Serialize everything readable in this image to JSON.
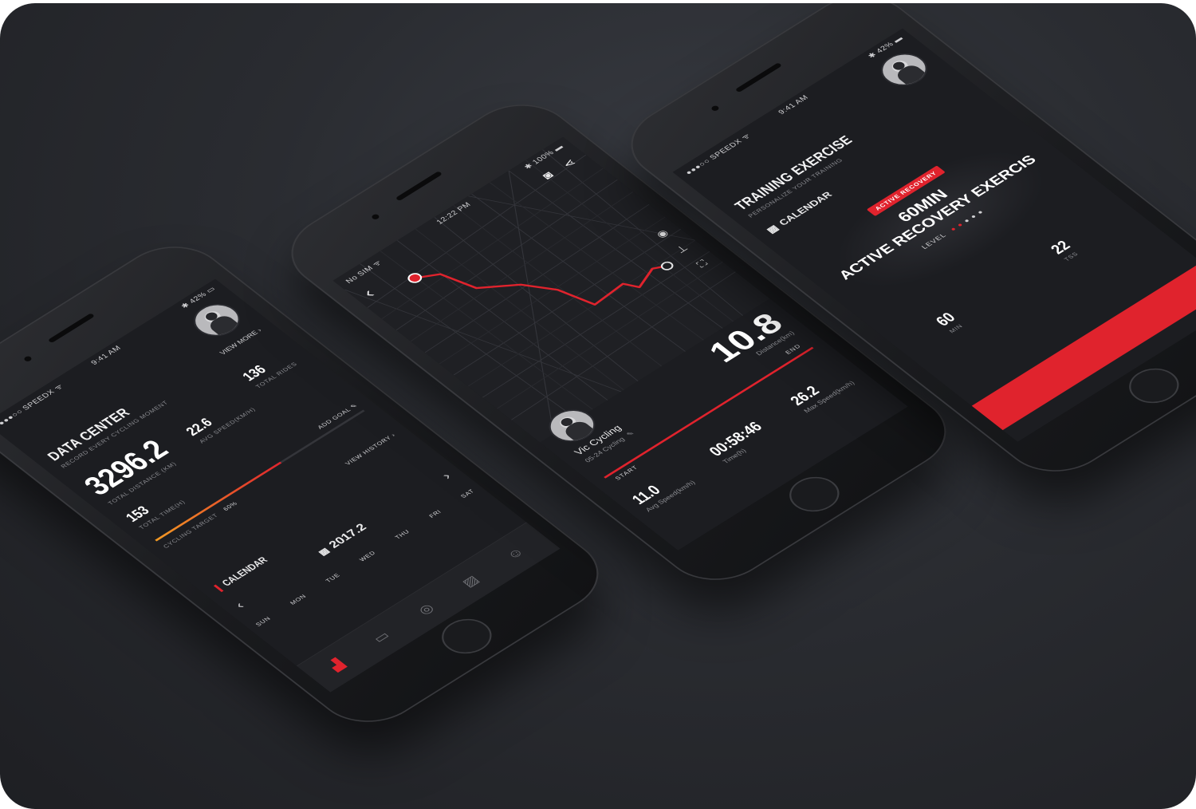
{
  "colors": {
    "accent": "#e0232d",
    "accent_orange": "#f39a23",
    "screen_bg": "#1c1d21",
    "text": "#e9e9ea",
    "muted": "#8b8c91"
  },
  "phone_left": {
    "status": {
      "carrier": "●●●○○ SPEEDX ᯤ",
      "time": "9:41 AM",
      "battery": "✱ 42% ▭"
    },
    "title": "DATA CENTER",
    "subtitle": "RECORD EVERY CYCLING MOMENT",
    "view_more": "VIEW MORE",
    "total_distance": {
      "value": "3296.2",
      "label": "TOTAL DISTANCE (KM)"
    },
    "avg_speed": {
      "value": "22.6",
      "label": "AVG SPEED(KM/H)"
    },
    "total_rides": {
      "value": "136",
      "label": "TOTAL RIDES"
    },
    "total_time": {
      "value": "153",
      "label": "TOTAL TIME(H)"
    },
    "add_goal": "ADD GOAL",
    "cycling_target": {
      "label": "CYCLING TARGET",
      "value": "60%",
      "progress": 0.6
    },
    "view_history": "VIEW HISTORY",
    "calendar_label": "CALENDAR",
    "calendar_month": "2017.2",
    "weekdays": [
      "SUN",
      "MON",
      "TUE",
      "WED",
      "THU",
      "FRI",
      "SAT"
    ],
    "tabs": [
      {
        "name": "tab-stats",
        "icon": "bar-chart-icon",
        "glyph": "▟"
      },
      {
        "name": "tab-device",
        "icon": "device-icon",
        "glyph": "▭"
      },
      {
        "name": "tab-ride",
        "icon": "target-icon",
        "glyph": "◎"
      },
      {
        "name": "tab-training",
        "icon": "training-icon",
        "glyph": "▨"
      },
      {
        "name": "tab-profile",
        "icon": "smile-icon",
        "glyph": "☺"
      }
    ]
  },
  "phone_middle": {
    "status": {
      "carrier": "No SIM ᯤ",
      "time": "12:22 PM",
      "battery": "✱ 100% ▬"
    },
    "back": "‹",
    "rider_name": "Vic Cycling",
    "ride_date": "05-24 Cycling",
    "distance": {
      "value": "10.8",
      "label": "Distance(km)"
    },
    "end_label": "END",
    "start_label": "START",
    "max_speed": {
      "value": "26.2",
      "label": "Max Speed(km/h)"
    },
    "time": {
      "value": "00:58:46",
      "label": "Time(h)"
    },
    "avg_speed": {
      "value": "11.0",
      "label": "Avg Speed(km/h)"
    }
  },
  "phone_right": {
    "status": {
      "carrier": "●●●○○ SPEEDX ᯤ",
      "time": "9:41 AM",
      "battery": "✱ 42% ▬"
    },
    "title": "TRAINING EXERCISE",
    "subtitle": "PERSONALIZE YOUR TRAINING",
    "calendar_label": "CALENDAR",
    "badge": "ACTIVE RECOVERY",
    "exercise_line1": "60MIN",
    "exercise_line2": "ACTIVE RECOVERY EXERCIS",
    "level_label": "LEVEL",
    "stat_a": {
      "value": "60",
      "label": "MIN"
    },
    "stat_b": {
      "value": "22",
      "label": "TSS"
    }
  }
}
